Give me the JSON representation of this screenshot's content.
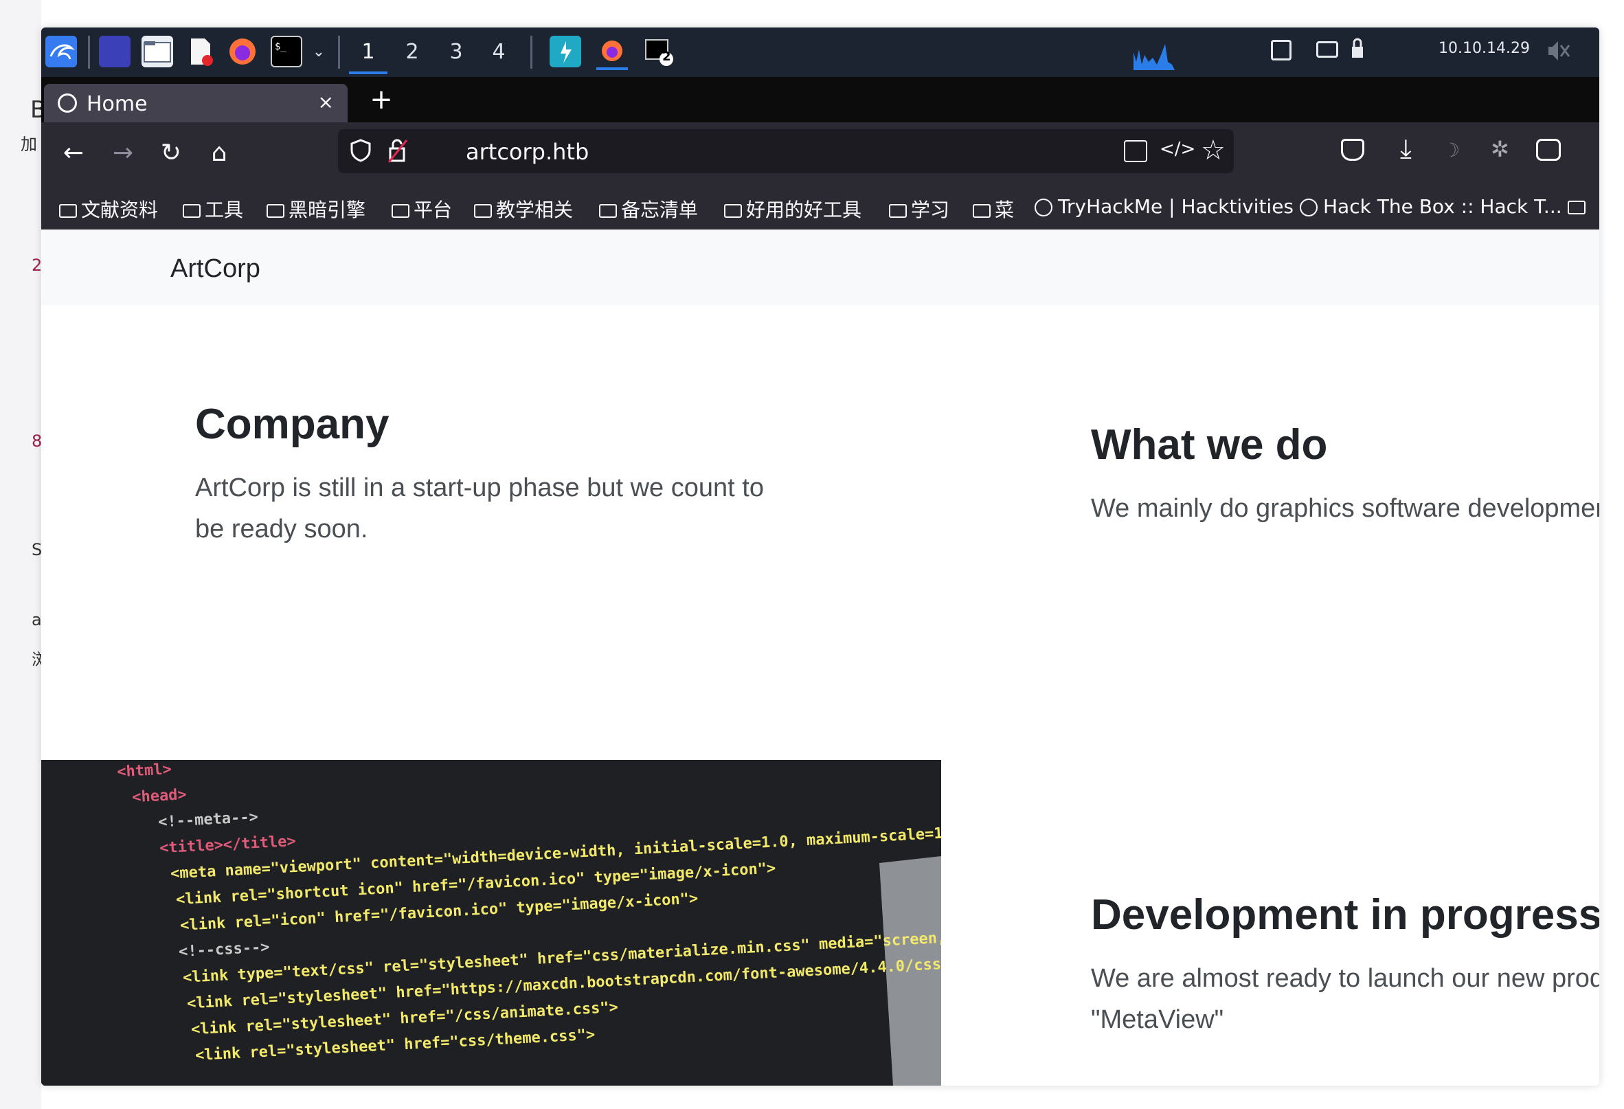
{
  "background_window": {
    "fragments": [
      "B",
      "加",
      "2",
      "8",
      "S",
      "a",
      "浏"
    ]
  },
  "taskbar": {
    "workspaces": [
      "1",
      "2",
      "3",
      "4"
    ],
    "active_workspace": "1",
    "terminal_badge": "2",
    "ip_address": "10.10.14.29",
    "accent": "#2b7de9"
  },
  "browser": {
    "tab": {
      "title": "Home",
      "close": "×"
    },
    "new_tab": "+",
    "url": "artcorp.htb",
    "bookmarks": [
      "文献资料",
      "工具",
      "黑暗引擎",
      "平台",
      "教学相关",
      "备忘清单",
      "好用的好工具",
      "学习",
      "菜",
      "TryHackMe | Hacktivities",
      "Hack The Box :: Hack T..."
    ]
  },
  "site": {
    "brand": "ArtCorp",
    "company": {
      "heading": "Company",
      "text_line1": "ArtCorp is still in a start-up phase but we count to",
      "text_line2": "be ready soon."
    },
    "what_we_do": {
      "heading": "What we do",
      "text": "We mainly do graphics software development"
    },
    "development": {
      "heading": "Development in progress",
      "text": "We are almost ready to launch our new product",
      "text_line2": "\"MetaView\""
    },
    "code_image": {
      "lines": [
        "<html>",
        "<head>",
        "<!--meta-->",
        "<title></title>",
        "<meta name=\"viewport\" content=\"width=device-width, initial-scale=1.0, maximum-scale=1.0, user-scalable=no\">",
        "<link rel=\"shortcut icon\" href=\"/favicon.ico\" type=\"image/x-icon\">",
        "<link rel=\"icon\" href=\"/favicon.ico\" type=\"image/x-icon\">",
        "<!--css-->",
        "<link type=\"text/css\" rel=\"stylesheet\" href=\"css/materialize.min.css\" media=\"screen,projection\">",
        "<link rel=\"stylesheet\" href=\"https://maxcdn.bootstrapcdn.com/font-awesome/4.4.0/css/font-awesome.min.css\">",
        "<link rel=\"stylesheet\" href=\"/css/animate.css\">",
        "<link rel=\"stylesheet\" href=\"css/theme.css\">"
      ]
    }
  }
}
